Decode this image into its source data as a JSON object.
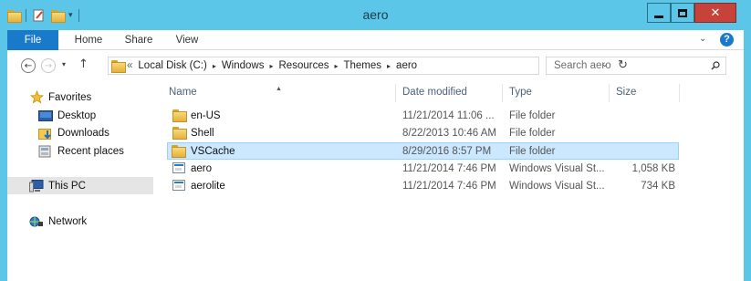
{
  "window": {
    "title": "aero",
    "quick_access_icons": [
      "properties-icon",
      "new-folder-icon",
      "customize-qat-icon"
    ],
    "controls": [
      "minimize-icon",
      "maximize-icon",
      "close-icon"
    ],
    "close_glyph": "✕"
  },
  "ribbon": {
    "tabs": [
      "File",
      "Home",
      "Share",
      "View"
    ],
    "active_tab": "File",
    "help_glyph": "?",
    "expand_glyph": "⌄"
  },
  "navigation": {
    "back_glyph": "←",
    "forward_glyph": "→",
    "recent_glyph": "▾",
    "up_glyph": "↑",
    "address_prefix": "«",
    "breadcrumb": [
      "Local Disk (C:)",
      "Windows",
      "Resources",
      "Themes",
      "aero"
    ],
    "breadcrumb_separator": "▸",
    "address_dropdown_glyph": "⌄",
    "refresh_glyph": "↻",
    "search_placeholder": "Search aero"
  },
  "nav_pane": {
    "favorites_label": "Favorites",
    "favorites": [
      "Desktop",
      "Downloads",
      "Recent places"
    ],
    "this_pc_label": "This PC",
    "network_label": "Network"
  },
  "file_list": {
    "columns": [
      "Name",
      "Date modified",
      "Type",
      "Size"
    ],
    "sorted_by": "Name",
    "rows": [
      {
        "name": "en-US",
        "date": "11/21/2014 11:06 ...",
        "type": "File folder",
        "size": "",
        "icon": "folder-icon"
      },
      {
        "name": "Shell",
        "date": "8/22/2013 10:46 AM",
        "type": "File folder",
        "size": "",
        "icon": "folder-icon"
      },
      {
        "name": "VSCache",
        "date": "8/29/2016 8:57 PM",
        "type": "File folder",
        "size": "",
        "icon": "folder-icon",
        "selected": true
      },
      {
        "name": "aero",
        "date": "11/21/2014 7:46 PM",
        "type": "Windows Visual St...",
        "size": "1,058 KB",
        "icon": "visual-style-file-icon"
      },
      {
        "name": "aerolite",
        "date": "11/21/2014 7:46 PM",
        "type": "Windows Visual St...",
        "size": "734 KB",
        "icon": "visual-style-file-icon"
      }
    ]
  },
  "colors": {
    "title_bar": "#5bc6e8",
    "file_tab": "#1979ca",
    "close_button": "#c7433a",
    "selection_fill": "#cce8ff",
    "selection_border": "#99d1ff"
  }
}
